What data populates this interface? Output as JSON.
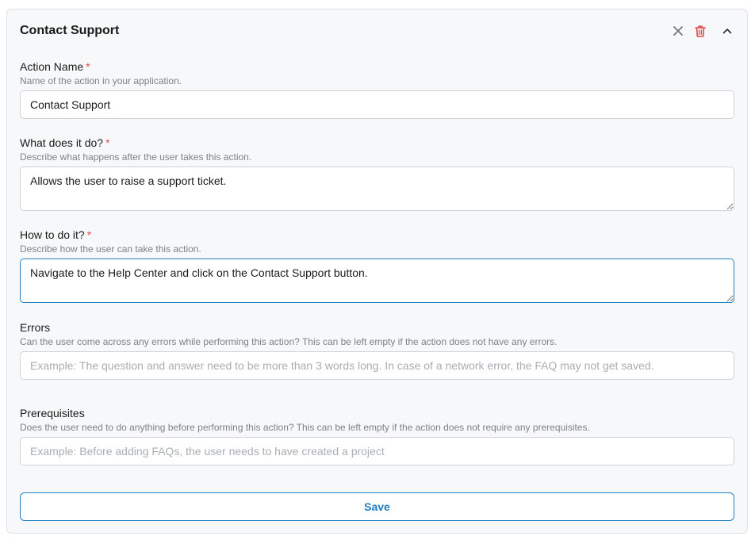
{
  "header": {
    "title": "Contact Support",
    "icons": [
      "close-icon",
      "trash-icon",
      "chevron-up-icon"
    ]
  },
  "fields": {
    "action_name": {
      "label": "Action Name",
      "required_mark": "*",
      "help": "Name of the action in your application.",
      "value": "Contact Support"
    },
    "what_does_it_do": {
      "label": "What does it do?",
      "required_mark": "*",
      "help": "Describe what happens after the user takes this action.",
      "value": "Allows the user to raise a support ticket."
    },
    "how_to_do_it": {
      "label": "How to do it?",
      "required_mark": "*",
      "help": "Describe how the user can take this action.",
      "value": "Navigate to the Help Center and click on the Contact Support button."
    },
    "errors": {
      "label": "Errors",
      "help": "Can the user come across any errors while performing this action? This can be left empty if the action does not have any errors.",
      "placeholder": "Example: The question and answer need to be more than 3 words long. In case of a network error, the FAQ may not get saved.",
      "value": ""
    },
    "prerequisites": {
      "label": "Prerequisites",
      "help": "Does the user need to do anything before performing this action? This can be left empty if the action does not require any prerequisites.",
      "placeholder": "Example: Before adding FAQs, the user needs to have created a project",
      "value": ""
    }
  },
  "actions": {
    "save_label": "Save"
  },
  "colors": {
    "accent": "#1f7fc0",
    "danger": "#e5484d",
    "card_background": "#f7f8f9"
  }
}
